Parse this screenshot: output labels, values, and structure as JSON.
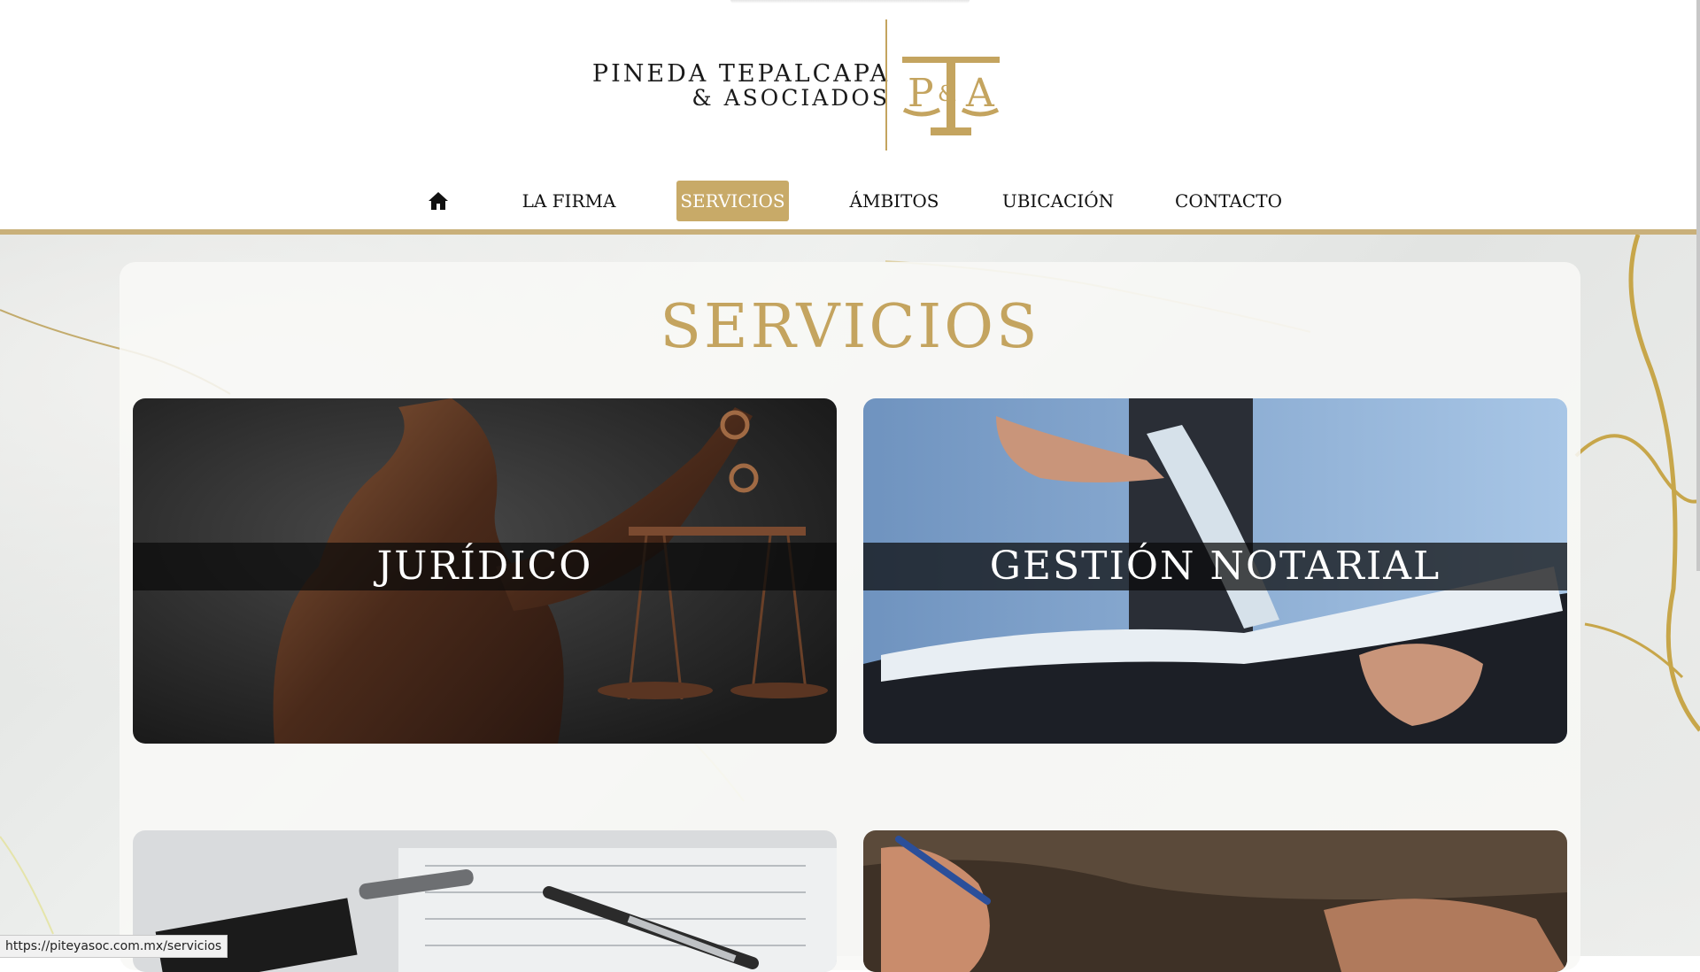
{
  "brand": {
    "name_line1": "PINEDA TEPALCAPA",
    "name_line2": "& ASOCIADOS",
    "monogram": "P&A",
    "gold": "#c4a45f"
  },
  "nav": {
    "home_icon": "home-icon",
    "items": [
      "LA FIRMA",
      "SERVICIOS",
      "ÁMBITOS",
      "UBICACIÓN",
      "CONTACTO"
    ],
    "active": "SERVICIOS",
    "active_color": "#c8aa68"
  },
  "page": {
    "title": "SERVICIOS"
  },
  "cards": [
    {
      "label": "JURÍDICO"
    },
    {
      "label": "GESTIÓN NOTARIAL"
    },
    {
      "label": ""
    },
    {
      "label": ""
    }
  ],
  "status_bar": {
    "url": "https://piteyasoc.com.mx/servicios"
  }
}
